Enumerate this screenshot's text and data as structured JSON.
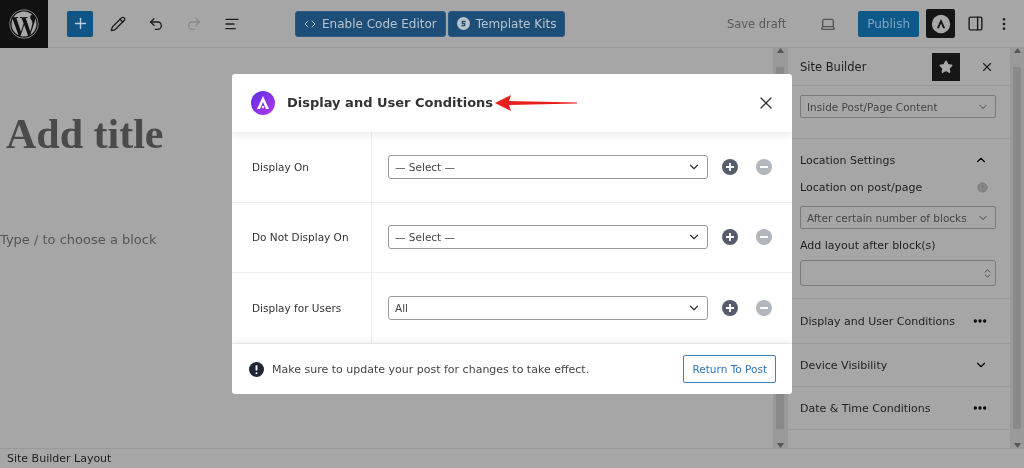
{
  "topbar": {
    "tools": [
      {
        "kind": "add",
        "disabled": false
      },
      {
        "kind": "edit",
        "disabled": false
      },
      {
        "kind": "undo",
        "disabled": false
      },
      {
        "kind": "redo",
        "disabled": true
      },
      {
        "kind": "outline",
        "disabled": false
      }
    ],
    "buttons": [
      {
        "kind": "code",
        "label": "Enable Code Editor"
      },
      {
        "kind": "kits",
        "label": "Template Kits"
      }
    ],
    "save_draft": "Save draft",
    "publish": "Publish"
  },
  "editor": {
    "title_placeholder": "Add title",
    "block_placeholder": "Type / to choose a block"
  },
  "sidebar": {
    "title": "Site Builder",
    "layout_select": "Inside Post/Page Content",
    "location": {
      "title": "Location Settings",
      "expanded": true,
      "position_label": "Location on post/page",
      "position_value": "After certain number of blocks",
      "after_label": "Add layout after block(s)"
    },
    "panels": [
      {
        "kind": "menu",
        "title": "Display and User Conditions"
      },
      {
        "kind": "toggle",
        "title": "Device Visibility",
        "expanded": false
      },
      {
        "kind": "menu",
        "title": "Date & Time Conditions"
      }
    ]
  },
  "modal": {
    "title": "Display and User Conditions",
    "rows": [
      {
        "label": "Display On",
        "value": "— Select —"
      },
      {
        "label": "Do Not Display On",
        "value": "— Select —"
      },
      {
        "label": "Display for Users",
        "value": "All"
      }
    ],
    "notice": "Make sure to update your post for changes to take effect.",
    "button": "Return To Post"
  },
  "status_bar": "Site Builder Layout"
}
